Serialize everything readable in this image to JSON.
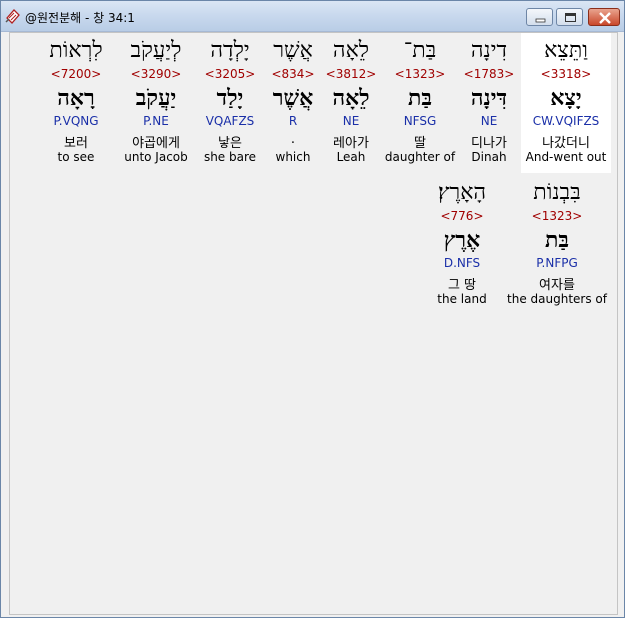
{
  "window": {
    "title": "@원전분해 - 창 34:1",
    "buttons": {
      "minimize": "minimize",
      "maximize": "maximize",
      "close": "close"
    }
  },
  "words": [
    {
      "id": "w1",
      "heb": "לִרְאוֹת",
      "strong": "<7200>",
      "root": "רָאָה",
      "parse": "P.VQNG",
      "ko": "보러",
      "en": "to see"
    },
    {
      "id": "w2",
      "heb": "לְיַעֲקֹב",
      "strong": "<3290>",
      "root": "יַעֲקֹב",
      "parse": "P.NE",
      "ko": "야곱에게",
      "en": "unto Jacob"
    },
    {
      "id": "w3",
      "heb": "יָלְדָה",
      "strong": "<3205>",
      "root": "יָלַד",
      "parse": "VQAFZS",
      "ko": "낳은",
      "en": "she bare"
    },
    {
      "id": "w4",
      "heb": "אֲשֶׁר",
      "strong": "<834>",
      "root": "אֲשֶׁר",
      "parse": "R",
      "ko": ".",
      "en": "which"
    },
    {
      "id": "w5",
      "heb": "לֵאָה",
      "strong": "<3812>",
      "root": "לֵאָה",
      "parse": "NE",
      "ko": "레아가",
      "en": "Leah"
    },
    {
      "id": "w6",
      "heb": "בַּת־",
      "strong": "<1323>",
      "root": "בַּת",
      "parse": "NFSG",
      "ko": "딸",
      "en": "daughter of"
    },
    {
      "id": "w7",
      "heb": "דִינָה",
      "strong": "<1783>",
      "root": "דִּינָה",
      "parse": "NE",
      "ko": "디나가",
      "en": "Dinah"
    },
    {
      "id": "w8",
      "heb": "וַתֵּצֵא",
      "strong": "<3318>",
      "root": "יָצָא",
      "parse": "CW.VQIFZS",
      "ko": "나갔더니",
      "en": "And-went out"
    },
    {
      "id": "w9",
      "heb": "הָאָרֶץ׃",
      "strong": "<776>",
      "root": "אֶרֶץ",
      "parse": "D.NFS",
      "ko": "그 땅",
      "en": "the land"
    },
    {
      "id": "w10",
      "heb": "בִּבְנוֹת",
      "strong": "<1323>",
      "root": "בַּת",
      "parse": "P.NFPG",
      "ko": "여자를",
      "en": "the daughters of"
    }
  ]
}
